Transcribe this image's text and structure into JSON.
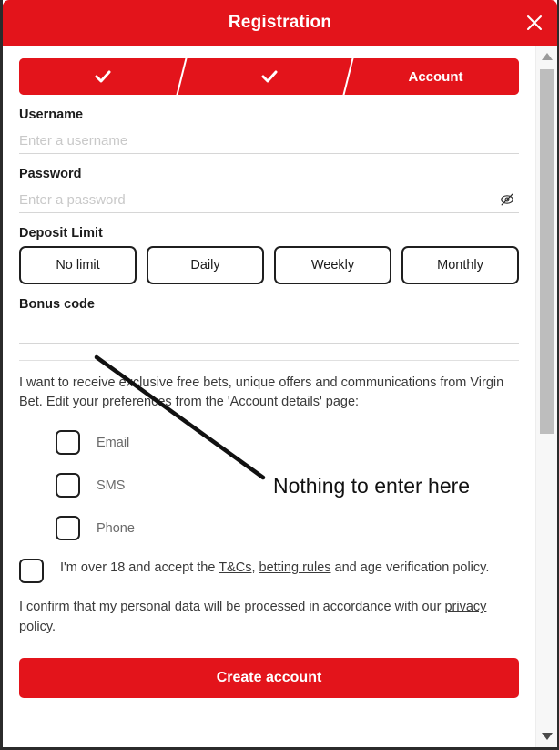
{
  "window": {
    "title": "Registration",
    "close_icon": "close-icon",
    "brand_color": "#e3141b"
  },
  "stepper": {
    "steps": [
      {
        "label": "",
        "state": "completed",
        "icon": "check-icon"
      },
      {
        "label": "",
        "state": "completed",
        "icon": "check-icon"
      },
      {
        "label": "Account",
        "state": "current",
        "icon": ""
      }
    ]
  },
  "form": {
    "username": {
      "label": "Username",
      "placeholder": "Enter a username",
      "value": ""
    },
    "password": {
      "label": "Password",
      "placeholder": "Enter a password",
      "value": "",
      "toggle_icon": "eye-off-icon"
    },
    "deposit_limit": {
      "label": "Deposit Limit",
      "options": [
        "No limit",
        "Daily",
        "Weekly",
        "Monthly"
      ],
      "selected": ""
    },
    "bonus_code": {
      "label": "Bonus code",
      "placeholder": "",
      "value": ""
    }
  },
  "marketing": {
    "intro": "I want to receive exclusive free bets, unique offers and communications from Virgin Bet. Edit your preferences from the 'Account details' page:",
    "channels": [
      {
        "label": "Email",
        "checked": false
      },
      {
        "label": "SMS",
        "checked": false
      },
      {
        "label": "Phone",
        "checked": false
      }
    ]
  },
  "terms": {
    "checked": false,
    "text_part_1": "I'm over 18 and accept the ",
    "link_tcs": "T&Cs",
    "text_part_2": ", ",
    "link_betting_rules": "betting rules",
    "text_part_3": " and age verification policy.",
    "privacy_text": "I confirm that my personal data will be processed in accordance with our ",
    "privacy_link": "privacy policy."
  },
  "submit": {
    "label": "Create account"
  },
  "scrollbar": {
    "up_icon": "chevron-up-icon",
    "down_icon": "chevron-down-icon"
  },
  "annotation": {
    "text": "Nothing to enter here"
  }
}
